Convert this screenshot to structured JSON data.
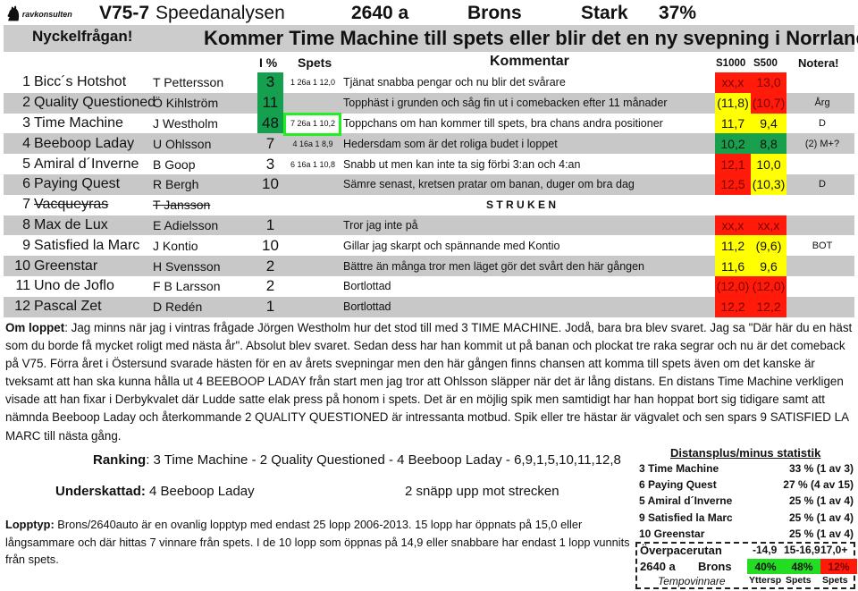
{
  "header": {
    "logo_text": "ravkonsulten",
    "race": "V75-7",
    "title": "Speedanalysen",
    "distance": "2640 a",
    "class": "Brons",
    "strength": "Stark",
    "percent": "37%"
  },
  "key_question": {
    "label": "Nyckelfrågan!",
    "text": "Kommer Time Machine till spets eller blir det en ny svepning i Norrland?"
  },
  "columns": {
    "ipct": "I %",
    "spets": "Spets",
    "comment": "Kommentar",
    "s1000": "S1000",
    "s500": "S500",
    "note": "Notera!"
  },
  "colors": {
    "red": "#ff1a0a",
    "yellow": "#ffff00",
    "green": "#18a04c",
    "highlight": "#22ee22",
    "row_alt": "#c8c8c8"
  },
  "horses": [
    {
      "num": "1",
      "name": "Bicc´s Hotshot",
      "driver": "T Pettersson",
      "ipct": "3",
      "spets": "1 26a 1 12,0",
      "comment": "Tjänat snabba pengar och nu blir det svårare",
      "s1000": "xx,x",
      "s1000_color": "red",
      "s500": "13,0",
      "s500_color": "red",
      "note": ""
    },
    {
      "num": "2",
      "name": "Quality Questioned",
      "driver": "Ö Kihlström",
      "ipct": "11",
      "spets": "",
      "comment": "Topphäst i grunden och såg fin ut i comebacken efter 11 månader",
      "s1000": "(11,8)",
      "s1000_color": "yel",
      "s500": "(10,7)",
      "s500_color": "red",
      "note": "Årg"
    },
    {
      "num": "3",
      "name": "Time Machine",
      "driver": "J Westholm",
      "ipct": "48",
      "spets": "7 26a 1 10,2",
      "comment": "Toppchans om han kommer till spets, bra chans andra positioner",
      "s1000": "11,7",
      "s1000_color": "yel",
      "s500": "9,4",
      "s500_color": "yel",
      "note": "D"
    },
    {
      "num": "4",
      "name": "Beeboop Laday",
      "driver": "U Ohlsson",
      "ipct": "7",
      "spets": "4 16a 1 8,9",
      "comment": "Hedersdam som är det roliga budet i loppet",
      "s1000": "10,2",
      "s1000_color": "grn",
      "s500": "8,8",
      "s500_color": "grn",
      "note": "(2) M+?"
    },
    {
      "num": "5",
      "name": "Amiral d´Inverne",
      "driver": "B Goop",
      "ipct": "3",
      "spets": "6 16a 1 10,8",
      "comment": "Snabb ut men kan inte ta sig förbi 3:an och 4:an",
      "s1000": "12,1",
      "s1000_color": "red",
      "s500": "10,0",
      "s500_color": "yel",
      "note": ""
    },
    {
      "num": "6",
      "name": "Paying Quest",
      "driver": "R Bergh",
      "ipct": "10",
      "spets": "",
      "comment": "Sämre senast, kretsen pratar om banan, duger om bra dag",
      "s1000": "12,5",
      "s1000_color": "red",
      "s500": "(10,3)",
      "s500_color": "yel",
      "note": "D"
    },
    {
      "num": "7",
      "name": "Vacqueyras",
      "driver": "T Jansson",
      "ipct": "",
      "spets": "",
      "comment": "S T R U K E N",
      "s1000": "",
      "s1000_color": "",
      "s500": "",
      "s500_color": "",
      "note": "",
      "scratched": true
    },
    {
      "num": "8",
      "name": "Max de Lux",
      "driver": "E Adielsson",
      "ipct": "1",
      "spets": "",
      "comment": "Tror jag inte på",
      "s1000": "xx,x",
      "s1000_color": "red",
      "s500": "xx,x",
      "s500_color": "red",
      "note": ""
    },
    {
      "num": "9",
      "name": "Satisfied la Marc",
      "driver": "J Kontio",
      "ipct": "10",
      "spets": "",
      "comment": "Gillar jag skarpt och spännande med Kontio",
      "s1000": "11,2",
      "s1000_color": "yel",
      "s500": "(9,6)",
      "s500_color": "yel",
      "note": "BOT"
    },
    {
      "num": "10",
      "name": "Greenstar",
      "driver": "H Svensson",
      "ipct": "2",
      "spets": "",
      "comment": "Bättre än många tror men läget gör det svårt den här gången",
      "s1000": "11,6",
      "s1000_color": "yel",
      "s500": "9,6",
      "s500_color": "yel",
      "note": ""
    },
    {
      "num": "11",
      "name": "Uno de Joflo",
      "driver": "F B Larsson",
      "ipct": "2",
      "spets": "",
      "comment": "Bortlottad",
      "s1000": "(12,0)",
      "s1000_color": "red",
      "s500": "(12,0)",
      "s500_color": "red",
      "note": ""
    },
    {
      "num": "12",
      "name": "Pascal Zet",
      "driver": "D Redén",
      "ipct": "1",
      "spets": "",
      "comment": "Bortlottad",
      "s1000": "12,2",
      "s1000_color": "red",
      "s500": "12,2",
      "s500_color": "red",
      "note": ""
    }
  ],
  "about": {
    "label": "Om loppet",
    "text": ": Jag minns när jag i vintras frågade Jörgen Westholm hur det stod till med 3 TIME MACHINE. Jodå, bara bra blev svaret. Jag sa \"Där här du en häst som du borde få mycket roligt med nästa år\". Absolut blev svaret. Sedan dess har han kommit ut på banan och plockat tre raka segrar och nu är det comeback på V75. Förra året i Östersund svarade hästen för en av årets svepningar men den här gången finns chansen att komma till spets även om det kanske är tveksamt att han ska kunna hålla ut 4 BEEBOOP LADAY från start men jag tror att Ohlsson släpper när det är lång distans. En distans Time Machine verkligen visade att han fixar i Derbykvalet där Ludde satte elak press på honom i spets. Det är en möjlig spik men samtidigt har han hoppat bort sig tidigare samt att nämnda Beeboop Laday och återkommande 2 QUALITY QUESTIONED är intressanta motbud. Spik eller tre hästar är vägvalet och sen spars 9 SATISFIED LA MARC till nästa gång."
  },
  "ranking": {
    "label": "Ranking",
    "text": ": 3 Time Machine - 2 Quality Questioned - 4 Beeboop Laday - 6,9,1,5,10,11,12,8"
  },
  "underrated": {
    "label": "Underskattad:",
    "text": " 4 Beeboop Laday",
    "note": "2 snäpp upp mot strecken"
  },
  "lopptyp": {
    "label": "Lopptyp:",
    "text": " Brons/2640auto är en ovanlig lopptyp med endast 25 lopp 2006-2013. 15 lopp har öppnats på 15,0 eller långsammare och där hittas 7 vinnare från spets. I de 10 lopp som öppnas på 14,9 eller snabbare har endast 1 lopp vunnits från spets."
  },
  "distance_stats": {
    "title": "Distansplus/minus statistik",
    "items": [
      {
        "horse": "3 Time Machine",
        "value": "33 % (1 av 3)"
      },
      {
        "horse": "6 Paying Quest",
        "value": "27 % (4 av 15)"
      },
      {
        "horse": "5 Amiral d´Inverne",
        "value": "25 % (1 av 4)"
      },
      {
        "horse": "9 Satisfied la Marc",
        "value": "25 % (1 av 4)"
      },
      {
        "horse": "10 Greenstar",
        "value": "25 % (1 av 4)"
      }
    ]
  },
  "overpace": {
    "label": "Överpacerutan",
    "distance": "2640 a",
    "class": "Brons",
    "tempo": "Tempovinnare",
    "cols": [
      {
        "range": "-14,9",
        "pct": "40%",
        "pos": "Yttersp",
        "color": "#22dd22"
      },
      {
        "range": "15-16,9",
        "pct": "48%",
        "pos": "Spets",
        "color": "#22dd22"
      },
      {
        "range": "17,0+",
        "pct": "12%",
        "pos": "Spets",
        "color": "#ff1a0a"
      }
    ]
  }
}
